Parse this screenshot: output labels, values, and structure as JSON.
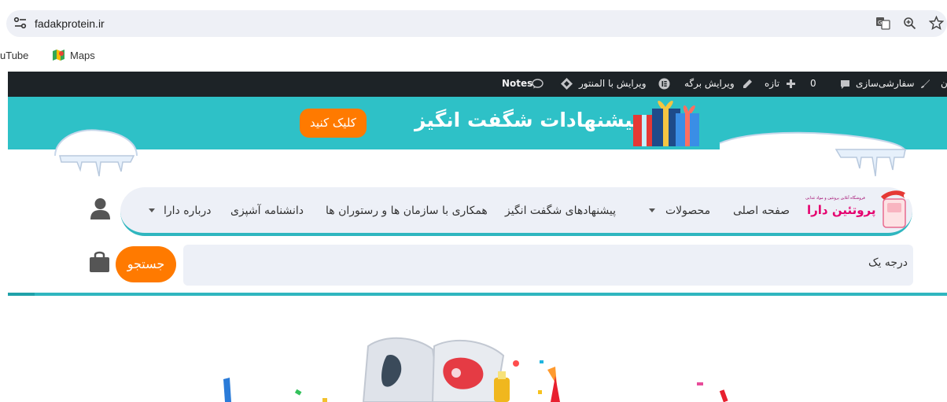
{
  "browser": {
    "url": "fadakprotein.ir",
    "icons": [
      "site-settings-icon",
      "translate-icon",
      "zoom-icon",
      "bookmark-star-icon"
    ]
  },
  "bookmarks": [
    {
      "label": "uTube"
    },
    {
      "label": "Maps"
    }
  ],
  "adminbar": {
    "customize": "سفارشی‌سازی",
    "comments_count": "0",
    "new": "تازه",
    "edit_page": "ویرایش برگه",
    "edit_elementor": "ویرایش با المنتور",
    "notes": "Notes"
  },
  "banner": {
    "title": "پیشنهادات شگفت انگیز",
    "cta": "کلیک کنید",
    "color": "#2ec1c7",
    "cta_color": "#ff7a00"
  },
  "logo": {
    "text": "پروتئین دارا",
    "tagline": "فروشگاه آنلاین پروتئین و مواد غذایی"
  },
  "nav": {
    "items": [
      {
        "label": "صفحه اصلی"
      },
      {
        "label": "محصولات"
      },
      {
        "label": "پیشنهادهای شگفت انگیز"
      },
      {
        "label": "همکاری با سازمان ها و رستوران ها"
      },
      {
        "label": "دانشنامه آشپزی"
      },
      {
        "label": "درباره دارا"
      }
    ]
  },
  "search": {
    "value": "درجه یک",
    "button": "جستجو"
  }
}
